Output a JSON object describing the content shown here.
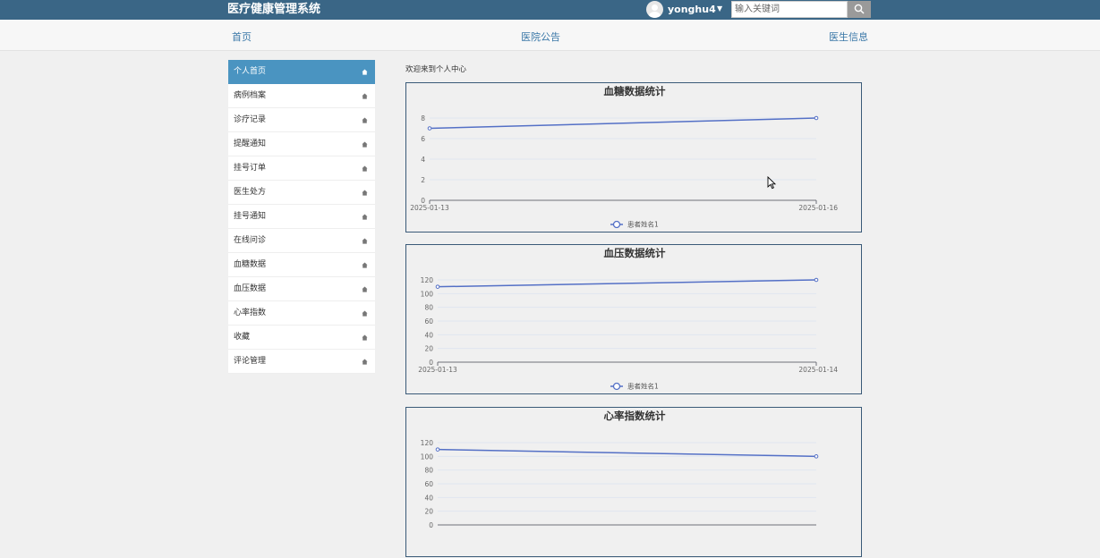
{
  "header": {
    "app_title": "医疗健康管理系统",
    "username": "yonghu4",
    "search_placeholder": "输入关键词",
    "icons": {
      "avatar": "user-avatar-icon",
      "dropdown": "caret-down-icon",
      "search": "search-icon"
    }
  },
  "nav": {
    "items": [
      {
        "label": "首页"
      },
      {
        "label": "医院公告"
      },
      {
        "label": "医生信息"
      }
    ]
  },
  "sidebar": {
    "items": [
      {
        "label": "个人首页",
        "active": true
      },
      {
        "label": "病例档案"
      },
      {
        "label": "诊疗记录"
      },
      {
        "label": "提醒通知"
      },
      {
        "label": "挂号订单"
      },
      {
        "label": "医生处方"
      },
      {
        "label": "挂号通知"
      },
      {
        "label": "在线问诊"
      },
      {
        "label": "血糖数据"
      },
      {
        "label": "血压数据"
      },
      {
        "label": "心率指数"
      },
      {
        "label": "收藏"
      },
      {
        "label": "评论管理"
      }
    ],
    "item_icon": "home-icon"
  },
  "main": {
    "welcome": "欢迎来到个人中心"
  },
  "colors": {
    "topbar": "#3a6686",
    "accent": "#4a94c1",
    "nav_link": "#3b78a8",
    "series": "#5470c6"
  },
  "chart_data": [
    {
      "type": "line",
      "title": "血糖数据统计",
      "categories": [
        "2025-01-13",
        "2025-01-16"
      ],
      "series": [
        {
          "name": "患者姓名1",
          "values": [
            7,
            8
          ]
        }
      ],
      "yticks": [
        0,
        2,
        4,
        6,
        8
      ],
      "ylim": [
        0,
        8
      ],
      "legend": "bottom-center"
    },
    {
      "type": "line",
      "title": "血压数据统计",
      "categories": [
        "2025-01-13",
        "2025-01-14"
      ],
      "series": [
        {
          "name": "患者姓名1",
          "values": [
            110,
            120
          ]
        }
      ],
      "yticks": [
        0,
        20,
        40,
        60,
        80,
        100,
        120
      ],
      "ylim": [
        0,
        120
      ],
      "legend": "bottom-center"
    },
    {
      "type": "line",
      "title": "心率指数统计",
      "series": [
        {
          "name": "",
          "values": [
            110,
            100
          ]
        }
      ],
      "yticks": [
        0,
        20,
        40,
        60,
        80,
        100,
        120
      ],
      "ylim": [
        0,
        120
      ]
    }
  ]
}
